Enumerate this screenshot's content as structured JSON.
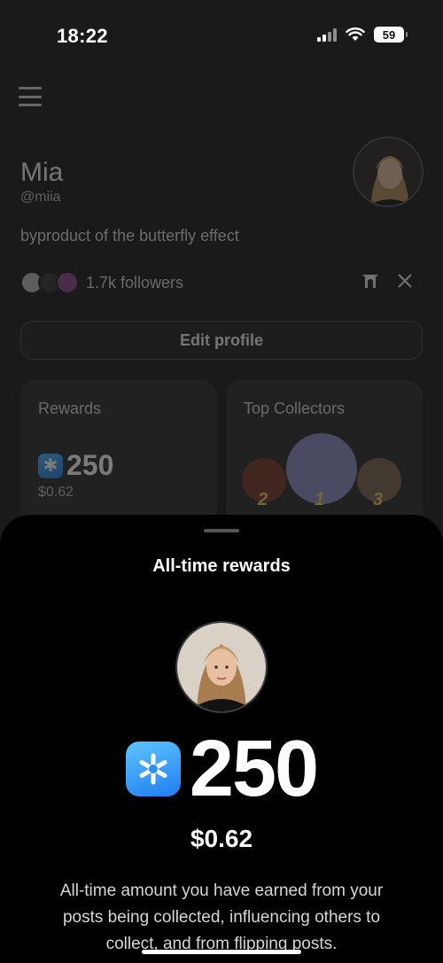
{
  "status": {
    "time": "18:22",
    "battery": "59"
  },
  "profile": {
    "name": "Mia",
    "handle": "@miia",
    "bio": "byproduct of the butterfly effect",
    "followers": "1.7k followers",
    "edit_button": "Edit profile"
  },
  "cards": {
    "rewards": {
      "label": "Rewards",
      "value": "250",
      "usd": "$0.62"
    },
    "collectors": {
      "label": "Top Collectors",
      "ranks": [
        "2",
        "1",
        "3"
      ]
    }
  },
  "sheet": {
    "title": "All-time rewards",
    "reward_value": "250",
    "reward_usd": "$0.62",
    "description": "All-time amount you have earned from your posts being collected, influencing others to collect, and from flipping posts."
  },
  "colors": {
    "accent": "#2b8ef5",
    "background": "#1a1a1a",
    "sheet": "#000000"
  },
  "icons": [
    "menu-icon",
    "farcaster-icon",
    "x-icon",
    "app-logo-icon",
    "signal-icon",
    "wifi-icon",
    "battery-icon"
  ]
}
